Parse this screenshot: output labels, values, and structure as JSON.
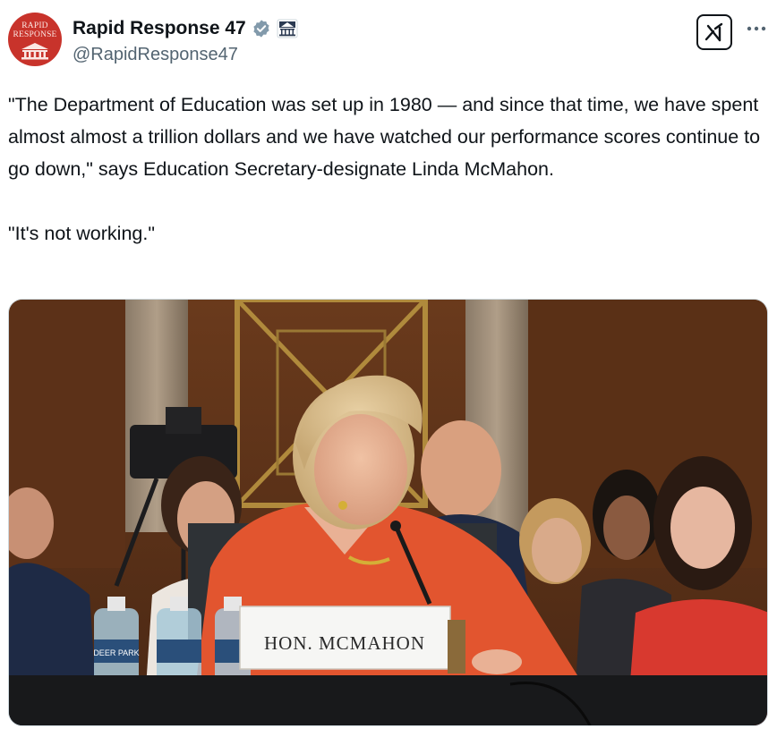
{
  "tweet": {
    "author_name": "Rapid Response 47",
    "handle": "@RapidResponse47",
    "avatar_text": [
      "RAPID",
      "RESPONSE"
    ],
    "text": "\"The Department of Education was set up in 1980 — and since that time, we have spent almost almost a trillion dollars and we have watched our performance scores continue to go down,\" says Education Secretary-designate Linda McMahon.\n\n\"It's not working.\"",
    "media": {
      "nameplate": "HON. MCMAHON",
      "bottle_label": "DEER PARK"
    }
  },
  "colors": {
    "verified_badge": "#829aab",
    "avatar_bg": "#c8332b",
    "jacket": "#e2552f"
  },
  "icons": {
    "verified": "verified-badge-icon",
    "affiliate": "government-building-icon",
    "grok": "grok-icon",
    "more": "more-options-icon"
  }
}
